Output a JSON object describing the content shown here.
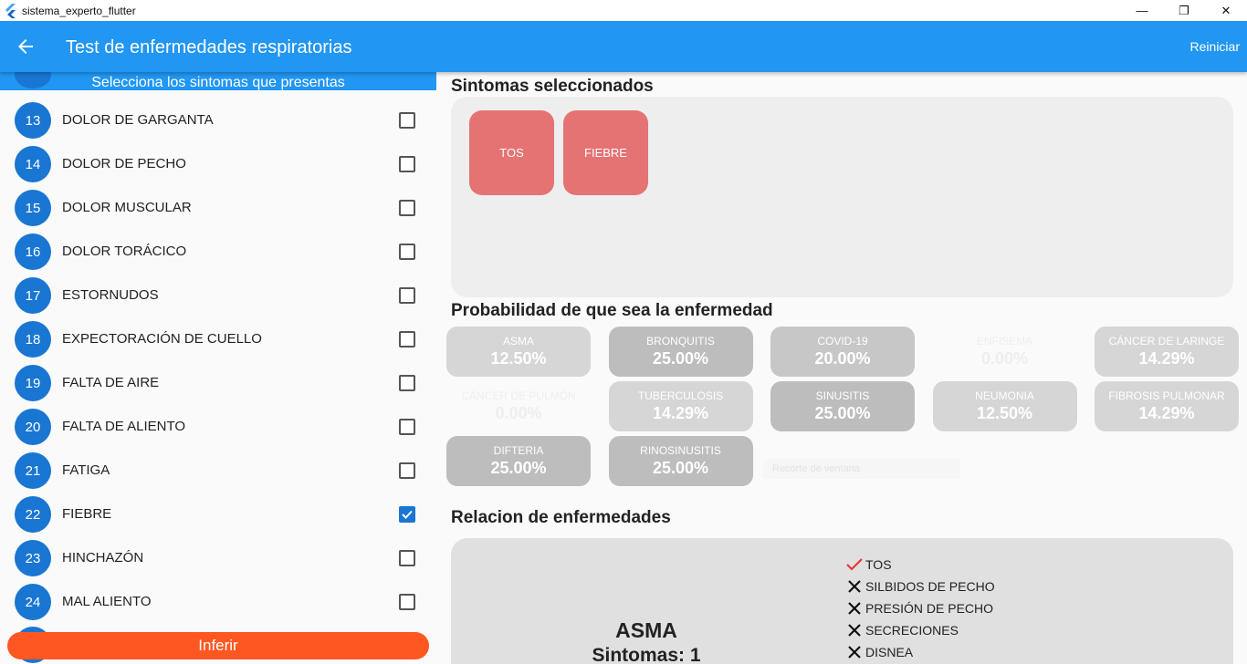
{
  "window": {
    "title": "sistema_experto_flutter",
    "minimize_glyph": "—",
    "restore_glyph": "❐",
    "close_glyph": "✕"
  },
  "appbar": {
    "title": "Test de enfermedades respiratorias",
    "reset_label": "Reiniciar",
    "color": "#2196f3"
  },
  "left": {
    "header": "Selecciona los sintomas que presentas",
    "symptoms": [
      {
        "num": "13",
        "label": "DOLOR DE GARGANTA",
        "checked": false
      },
      {
        "num": "14",
        "label": "DOLOR DE PECHO",
        "checked": false
      },
      {
        "num": "15",
        "label": "DOLOR MUSCULAR",
        "checked": false
      },
      {
        "num": "16",
        "label": "DOLOR TORÁCICO",
        "checked": false
      },
      {
        "num": "17",
        "label": "ESTORNUDOS",
        "checked": false
      },
      {
        "num": "18",
        "label": "EXPECTORACIÓN DE CUELLO",
        "checked": false
      },
      {
        "num": "19",
        "label": "FALTA DE AIRE",
        "checked": false
      },
      {
        "num": "20",
        "label": "FALTA DE ALIENTO",
        "checked": false
      },
      {
        "num": "21",
        "label": "FATIGA",
        "checked": false
      },
      {
        "num": "22",
        "label": "FIEBRE",
        "checked": true
      },
      {
        "num": "23",
        "label": "HINCHAZÓN",
        "checked": false
      },
      {
        "num": "24",
        "label": "MAL ALIENTO",
        "checked": false
      }
    ],
    "infer_label": "Inferir",
    "infer_color": "#ff5722"
  },
  "selected": {
    "title": "Sintomas seleccionados",
    "chips": [
      "TOS",
      "FIEBRE"
    ],
    "chip_color": "#e57373"
  },
  "probability": {
    "title": "Probabilidad de que sea la enfermedad",
    "cards": [
      {
        "name": "ASMA",
        "value": "12.50%",
        "tone": "light"
      },
      {
        "name": "BRONQUITIS",
        "value": "25.00%",
        "tone": "dark"
      },
      {
        "name": "COVID-19",
        "value": "20.00%",
        "tone": "mid"
      },
      {
        "name": "ENFISEMA",
        "value": "0.00%",
        "tone": "faint"
      },
      {
        "name": "CÁNCER DE LARINGE",
        "value": "14.29%",
        "tone": "light"
      },
      {
        "name": "CÁNCER DE PULMÓN",
        "value": "0.00%",
        "tone": "faint"
      },
      {
        "name": "TUBERCULOSIS",
        "value": "14.29%",
        "tone": "light"
      },
      {
        "name": "SINUSITIS",
        "value": "25.00%",
        "tone": "dark"
      },
      {
        "name": "NEUMONIA",
        "value": "12.50%",
        "tone": "light"
      },
      {
        "name": "FIBROSIS PULMONAR",
        "value": "14.29%",
        "tone": "light"
      },
      {
        "name": "DIFTERIA",
        "value": "25.00%",
        "tone": "dark"
      },
      {
        "name": "RINOSINUSITIS",
        "value": "25.00%",
        "tone": "dark"
      }
    ],
    "ghost_tooltip": "Recorte de ventana"
  },
  "relation": {
    "title": "Relacion de enfermedades",
    "disease": "ASMA",
    "symptom_count": "Sintomas: 1",
    "items": [
      {
        "label": "TOS",
        "match": true
      },
      {
        "label": "SILBIDOS DE PECHO",
        "match": false
      },
      {
        "label": "PRESIÓN DE PECHO",
        "match": false
      },
      {
        "label": "SECRECIONES",
        "match": false
      },
      {
        "label": "DISNEA",
        "match": false
      }
    ]
  }
}
